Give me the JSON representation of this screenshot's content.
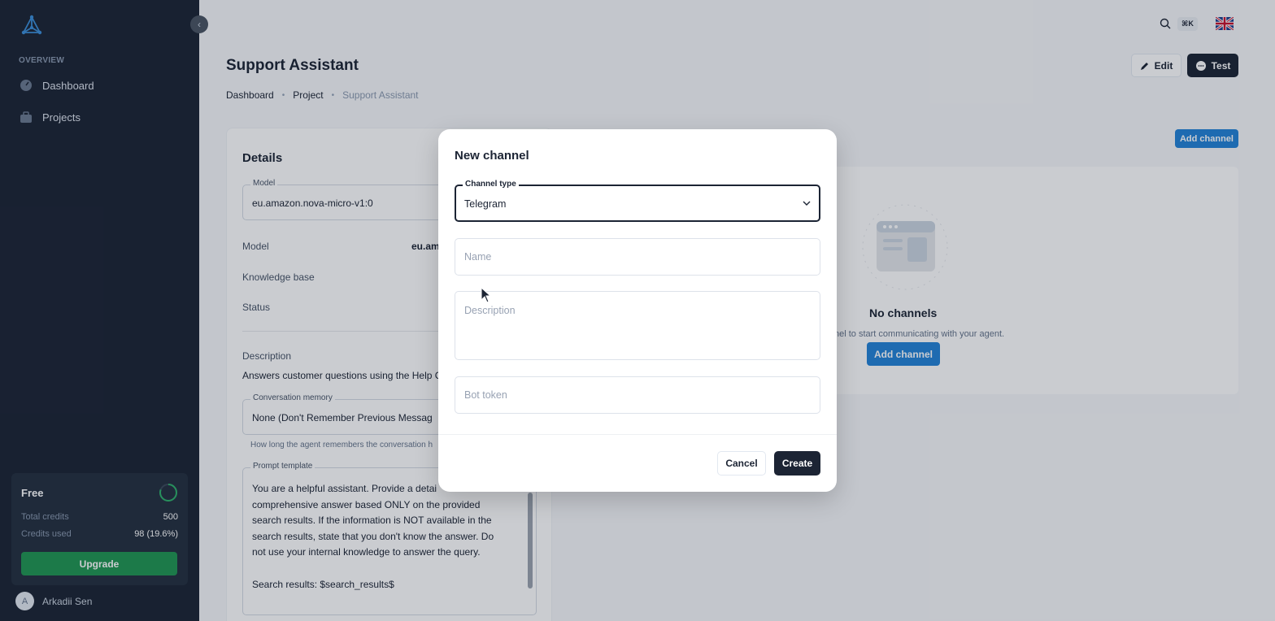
{
  "sidebar": {
    "section_label": "OVERVIEW",
    "items": [
      {
        "label": "Dashboard",
        "icon": "dashboard-icon"
      },
      {
        "label": "Projects",
        "icon": "briefcase-icon"
      }
    ],
    "plan": {
      "name": "Free",
      "rows": [
        {
          "key": "Total credits",
          "value": "500"
        },
        {
          "key": "Credits used",
          "value": "98 (19.6%)"
        }
      ],
      "usage_fraction": 0.196,
      "upgrade_label": "Upgrade"
    },
    "user": {
      "initial": "A",
      "name": "Arkadii Sen"
    }
  },
  "topbar": {
    "shortcut": "⌘K",
    "language_flag": "uk-flag-icon"
  },
  "header": {
    "title": "Support Assistant",
    "edit_label": "Edit",
    "test_label": "Test",
    "breadcrumb": [
      "Dashboard",
      "Project",
      "Support Assistant"
    ]
  },
  "details": {
    "title": "Details",
    "model_field": {
      "label": "Model",
      "value": "eu.amazon.nova-micro-v1:0"
    },
    "list": [
      {
        "key": "Model",
        "value": "eu.am"
      },
      {
        "key": "Knowledge base",
        "value": ""
      },
      {
        "key": "Status",
        "value": ""
      }
    ],
    "description_label": "Description",
    "description_value": "Answers customer questions using the Help C",
    "memory_field": {
      "label": "Conversation memory",
      "value": "None (Don't Remember Previous Messag"
    },
    "memory_helper": "How long the agent remembers the conversation h",
    "prompt_field": {
      "label": "Prompt template",
      "value": "You are a helpful assistant. Provide a detai\ncomprehensive answer based ONLY on the provided\nsearch results. If the information is NOT available in the\nsearch results, state that you don't know the answer. Do\nnot use your internal knowledge to answer the query.\n\nSearch results: $search_results$"
    }
  },
  "channels": {
    "add_label": "Add channel",
    "empty_title": "No channels",
    "empty_sub": "nel to start communicating with your agent.",
    "empty_add_label": "Add channel"
  },
  "modal": {
    "title": "New channel",
    "channel_type": {
      "label": "Channel type",
      "value": "Telegram"
    },
    "name_placeholder": "Name",
    "description_placeholder": "Description",
    "bot_token_placeholder": "Bot token",
    "cancel_label": "Cancel",
    "create_label": "Create"
  },
  "colors": {
    "sidebar_bg": "#1c2434",
    "primary_dark": "#1c2434",
    "accent_blue": "#2383d8",
    "upgrade_green": "#219653"
  }
}
